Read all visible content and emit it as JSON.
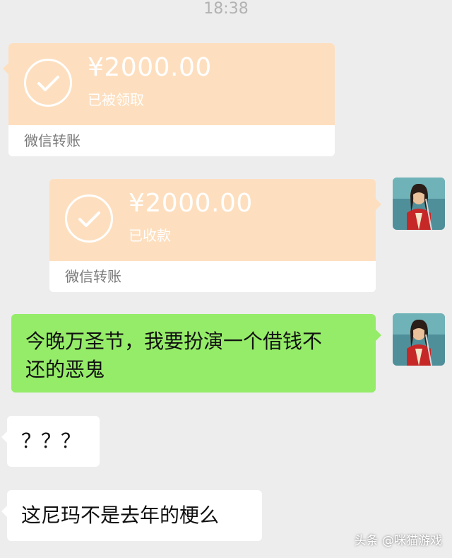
{
  "header": {
    "time": "18:38"
  },
  "messages": [
    {
      "type": "transfer",
      "side": "left",
      "amount": "¥2000.00",
      "status": "已被领取",
      "footer": "微信转账"
    },
    {
      "type": "transfer",
      "side": "right",
      "amount": "¥2000.00",
      "status": "已收款",
      "footer": "微信转账"
    },
    {
      "type": "text",
      "side": "right",
      "line1": "今晚万圣节，我要扮演一个借钱不",
      "line2": "还的恶鬼"
    },
    {
      "type": "text",
      "side": "left",
      "text": "？？？"
    },
    {
      "type": "text",
      "side": "left",
      "text": "这尼玛不是去年的梗么"
    }
  ],
  "watermark": "头条 @咪猫游戏",
  "colors": {
    "background": "#ededed",
    "transfer": "#fddfbf",
    "sent": "#95ec69",
    "received": "#ffffff"
  },
  "icons": {
    "transfer_status": "check-circle-icon",
    "avatar": "user-avatar-illustration"
  }
}
